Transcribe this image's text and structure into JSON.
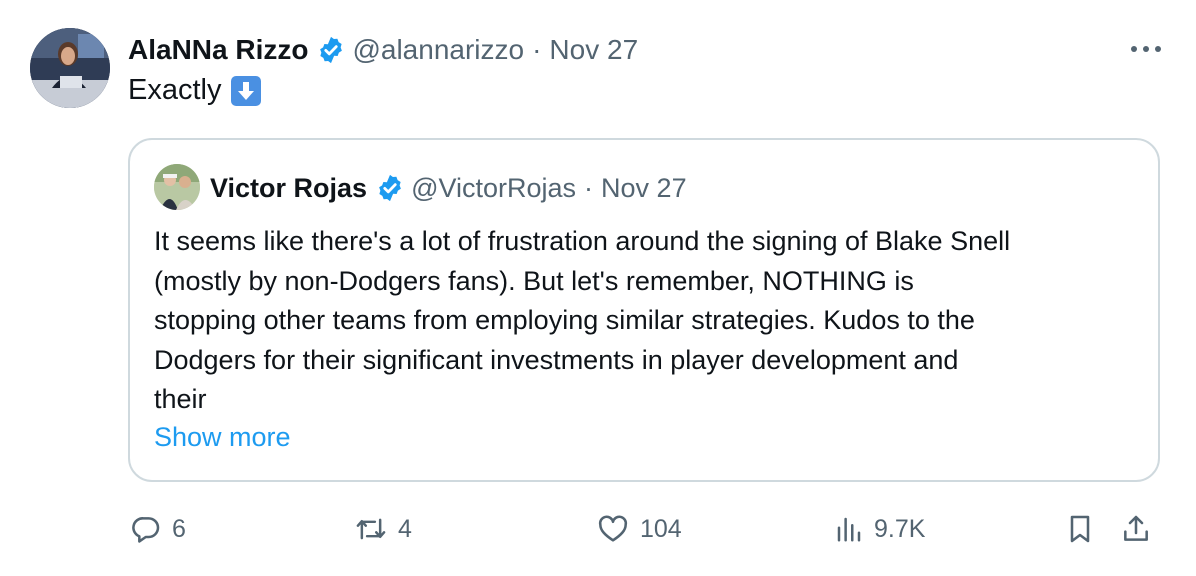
{
  "tweet": {
    "author_name": "AlaNNa Rizzo",
    "handle": "@alannarizzo",
    "separator": "·",
    "date": "Nov 27",
    "text": "Exactly",
    "emoji": "down-arrow-emoji-icon"
  },
  "quote": {
    "author_name": "Victor Rojas",
    "handle": "@VictorRojas",
    "separator": "·",
    "date": "Nov 27",
    "lines": [
      "It seems like there's a lot of frustration around the signing of Blake Snell",
      "(mostly by non-Dodgers fans). But let's remember, NOTHING is",
      "stopping other teams from employing similar strategies. Kudos to the",
      "Dodgers for their significant investments in player development and",
      "their"
    ],
    "show_more": "Show more"
  },
  "actions": {
    "replies": "6",
    "reposts": "4",
    "likes": "104",
    "views": "9.7K"
  },
  "colors": {
    "verified": "#1d9bf0",
    "link": "#1d9bf0",
    "muted": "#536471",
    "border": "#cfd9de"
  }
}
